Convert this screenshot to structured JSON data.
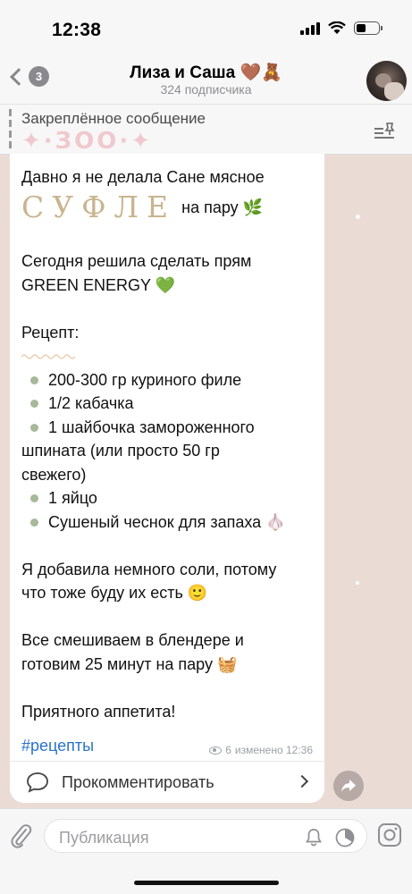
{
  "status_bar": {
    "time": "12:38"
  },
  "header": {
    "back_count": "3",
    "title": "Лиза и Саша 🤎🧸",
    "subtitle": "324 подписчика"
  },
  "pinned": {
    "label": "Закреплённое сообщение",
    "text": "✦·ЗОО·✦"
  },
  "message": {
    "line1": "Давно я не делала Сане мясное",
    "sufle_word": "СУФЛЕ",
    "sufle_after": "на пару 🌿",
    "line3": "Сегодня решила сделать прям",
    "line4": "GREEN ENERGY 💚",
    "recipe_label": "Рецепт:",
    "ingredients": [
      "200-300 гр куриного филе",
      "1/2 кабачка",
      "1 шайбочка замороженного",
      "1 яйцо",
      "Сушеный чеснок для запаха 🧄"
    ],
    "ingredient3_cont1": "шпината (или просто 50 гр",
    "ingredient3_cont2": "свежего)",
    "para1_line1": "Я добавила немного соли, потому",
    "para1_line2": "что тоже буду их есть 🙂",
    "para2_line1": "Все смешиваем в блендере и",
    "para2_line2": "готовим 25 минут на пару 🧺",
    "closing": "Приятного аппетита!",
    "hashtag": "#рецепты",
    "views": "6",
    "edited": "изменено 12:36"
  },
  "comments": {
    "label": "Прокомментировать"
  },
  "input": {
    "placeholder": "Публикация"
  },
  "colors": {
    "accent_link": "#2a73c8",
    "bubble_bg": "#ffffff",
    "chat_bg": "#eadcd5"
  }
}
